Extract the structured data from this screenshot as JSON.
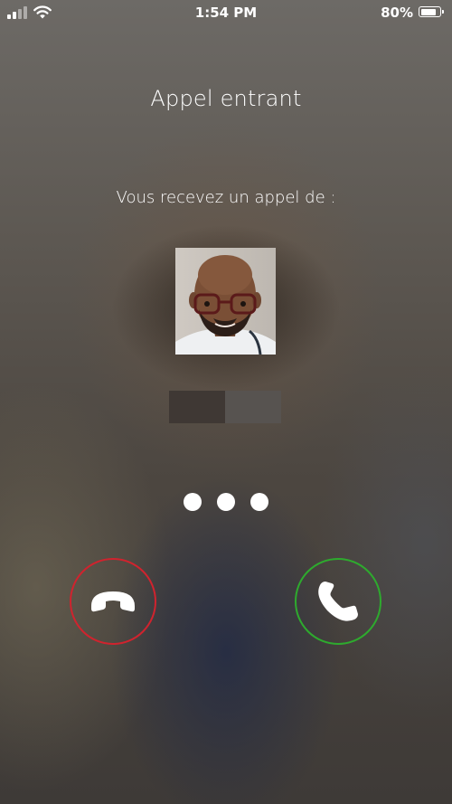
{
  "status_bar": {
    "time": "1:54 PM",
    "battery_percent": "80%",
    "battery_level": 0.8,
    "signal_bars_active": 2,
    "signal_bars_total": 4,
    "wifi_icon": "wifi-icon"
  },
  "call": {
    "title": "Appel entrant",
    "subtitle": "Vous recevez un appel de :",
    "caller_photo_icon": "caller-avatar"
  },
  "actions": {
    "decline_icon": "phone-hangup-icon",
    "decline_color": "#d0232e",
    "accept_icon": "phone-icon",
    "accept_color": "#2eaa2e"
  }
}
